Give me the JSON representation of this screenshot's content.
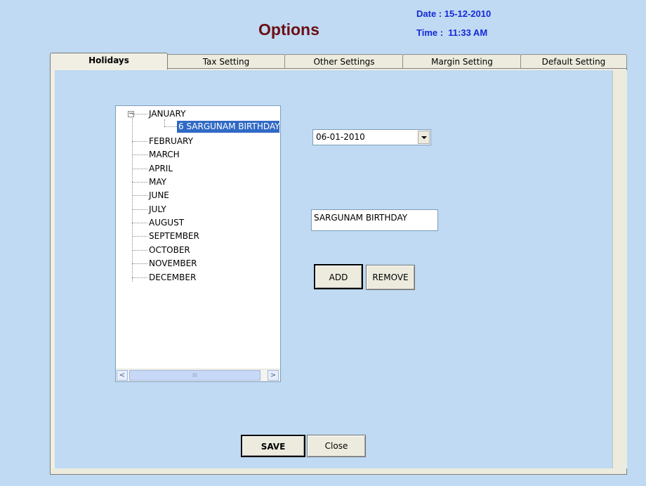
{
  "header": {
    "title": "Options",
    "date_text": "Date : 15-12-2010",
    "time_text": "Time :  11:33 AM",
    "title_color": "#6b0e15",
    "datetime_color": "#1428d6"
  },
  "tabs": [
    {
      "label": "Holidays",
      "active": true
    },
    {
      "label": "Tax Setting",
      "active": false
    },
    {
      "label": "Other Settings",
      "active": false
    },
    {
      "label": "Margin Setting",
      "active": false
    },
    {
      "label": "Default Setting",
      "active": false
    }
  ],
  "tree": {
    "expander_glyph": "−",
    "root_expanded": "JANUARY",
    "selected_child": "6 SARGUNAM BIRTHDAY",
    "months": [
      "JANUARY",
      "FEBRUARY",
      "MARCH",
      "APRIL",
      "MAY",
      "JUNE",
      "JULY",
      "AUGUST",
      "SEPTEMBER",
      "OCTOBER",
      "NOVEMBER",
      "DECEMBER"
    ],
    "scroll_left_glyph": "<",
    "scroll_right_glyph": ">",
    "scroll_thumb_glyph": "III"
  },
  "form": {
    "date_value": "06-01-2010",
    "description_value": "SARGUNAM BIRTHDAY",
    "add_label": "ADD",
    "remove_label": "REMOVE"
  },
  "footer": {
    "save_label": "SAVE",
    "close_label": "Close"
  },
  "colors": {
    "background": "#bfdaf2",
    "selection": "#316ac5"
  }
}
